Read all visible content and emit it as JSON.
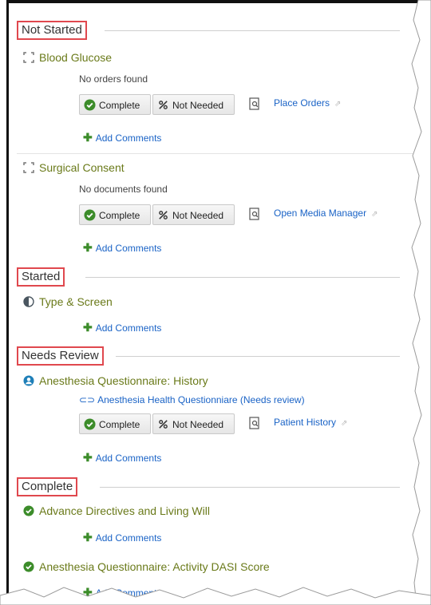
{
  "sections": {
    "not_started": "Not Started",
    "started": "Started",
    "needs_review": "Needs Review",
    "complete": "Complete"
  },
  "items": {
    "blood_glucose": {
      "title": "Blood Glucose",
      "status_text": "No orders found",
      "action_link": "Place Orders"
    },
    "surgical_consent": {
      "title": "Surgical Consent",
      "status_text": "No documents found",
      "action_link": "Open Media Manager"
    },
    "type_screen": {
      "title": "Type & Screen"
    },
    "anesthesia_history": {
      "title": "Anesthesia Questionnaire: History",
      "sub_link": "Anesthesia Health Questionniare (Needs review)",
      "action_link": "Patient History"
    },
    "advance_directives": {
      "title": "Advance Directives and Living Will"
    },
    "anesthesia_dasi": {
      "title": "Anesthesia Questionnaire: Activity DASI Score"
    }
  },
  "buttons": {
    "complete": "Complete",
    "not_needed": "Not Needed",
    "add_comments": "Add Comments"
  },
  "colors": {
    "title_green": "#6a7a1a",
    "link_blue": "#1a63c6",
    "highlight_red": "#e0484e",
    "check_green": "#3c8c2a"
  },
  "icons": {
    "not_started": "dashed-square-icon",
    "started": "half-circle-icon",
    "needs_review": "person-circle-icon",
    "complete": "check-circle-icon"
  }
}
